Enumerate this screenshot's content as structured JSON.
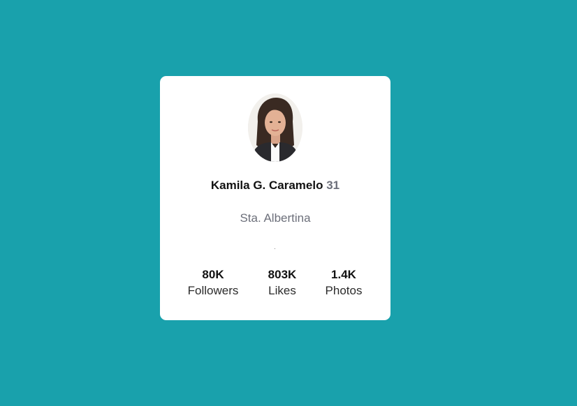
{
  "profile": {
    "name": "Kamila G. Caramelo",
    "age": "31",
    "location": "Sta. Albertina"
  },
  "stats": [
    {
      "value": "80K",
      "label": "Followers"
    },
    {
      "value": "803K",
      "label": "Likes"
    },
    {
      "value": "1.4K",
      "label": "Photos"
    }
  ],
  "colors": {
    "background": "#19a1ac",
    "card": "#ffffff",
    "muted_text": "#6c6f7a"
  }
}
